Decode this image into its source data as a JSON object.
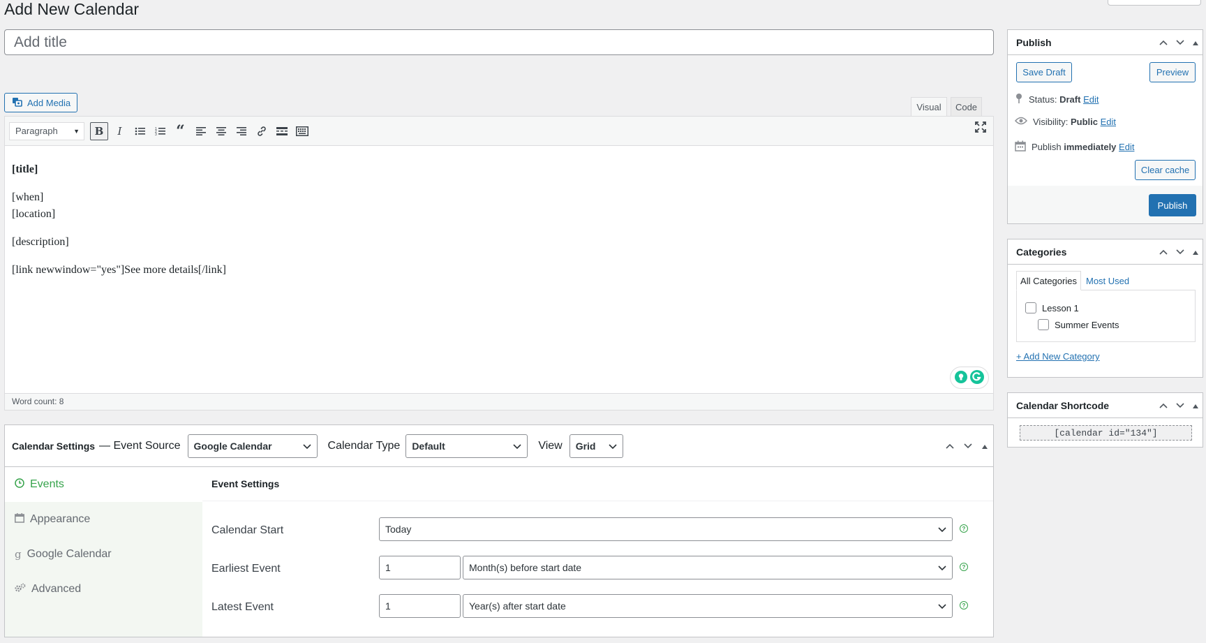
{
  "page": {
    "title": "Add New Calendar"
  },
  "title_field": {
    "placeholder": "Add title"
  },
  "media": {
    "add_media_label": "Add Media"
  },
  "editor": {
    "tabs": [
      "Visual",
      "Code"
    ],
    "format_select": "Paragraph",
    "toolbar_icons": [
      "bold-icon",
      "italic-icon",
      "bulleted-list-icon",
      "numbered-list-icon",
      "blockquote-icon",
      "align-left-icon",
      "align-center-icon",
      "align-right-icon",
      "link-icon",
      "read-more-icon",
      "toolbar-toggle-icon",
      "fullscreen-icon"
    ],
    "content": {
      "title_tag": "[title]",
      "when": "[when]",
      "location": "[location]",
      "description": "[description]",
      "link": "[link newwindow=\"yes\"]See more details[/link]"
    },
    "word_count": "Word count: 8"
  },
  "calendar_settings": {
    "title": "Calendar Settings",
    "event_source_label": "— Event Source",
    "event_source_value": "Google Calendar",
    "calendar_type_label": "Calendar Type",
    "calendar_type_value": "Default",
    "view_label": "View",
    "view_value": "Grid",
    "side_tabs": [
      "Events",
      "Appearance",
      "Google Calendar",
      "Advanced"
    ],
    "section_title": "Event Settings",
    "rows": {
      "start_label": "Calendar Start",
      "start_value": "Today",
      "earliest_label": "Earliest Event",
      "earliest_number": "1",
      "earliest_unit": "Month(s) before start date",
      "latest_label": "Latest Event",
      "latest_number": "1",
      "latest_unit": "Year(s) after start date"
    }
  },
  "publish": {
    "title": "Publish",
    "save_draft": "Save Draft",
    "preview": "Preview",
    "status_label": "Status:",
    "status_value": "Draft",
    "visibility_label": "Visibility:",
    "visibility_value": "Public",
    "publish_label": "Publish",
    "publish_value": "immediately",
    "edit": "Edit",
    "clear_cache": "Clear cache",
    "publish_button": "Publish"
  },
  "categories": {
    "title": "Categories",
    "tab_all": "All Categories",
    "tab_used": "Most Used",
    "items": [
      "Lesson 1",
      "Summer Events"
    ],
    "add_new": "+ Add New Category"
  },
  "shortcode": {
    "title": "Calendar Shortcode",
    "value": "[calendar id=\"134\"]"
  },
  "colors": {
    "accent": "#2271b1",
    "green": "#36a34b"
  }
}
